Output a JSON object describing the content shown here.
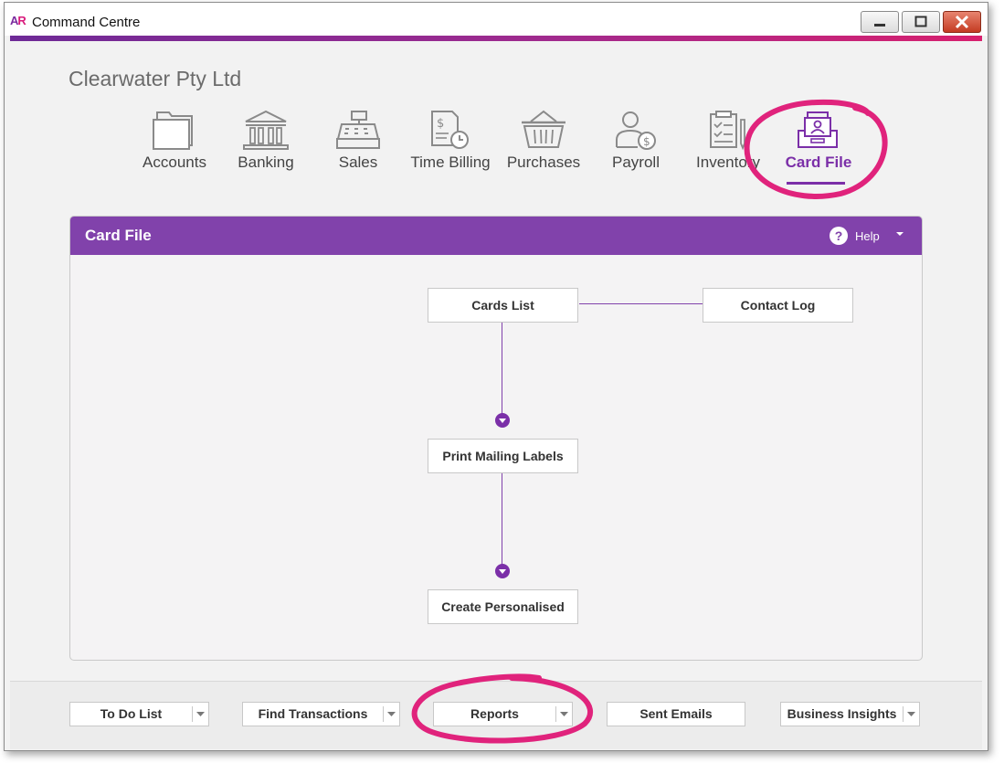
{
  "window": {
    "title": "Command Centre",
    "logo_a": "A",
    "logo_r": "R"
  },
  "company_name": "Clearwater Pty Ltd",
  "nav": {
    "tabs": [
      {
        "label": "Accounts",
        "icon": "folder-icon"
      },
      {
        "label": "Banking",
        "icon": "bank-icon"
      },
      {
        "label": "Sales",
        "icon": "cash-register-icon"
      },
      {
        "label": "Time Billing",
        "icon": "invoice-clock-icon"
      },
      {
        "label": "Purchases",
        "icon": "basket-icon"
      },
      {
        "label": "Payroll",
        "icon": "person-dollar-icon"
      },
      {
        "label": "Inventory",
        "icon": "clipboard-icon"
      },
      {
        "label": "Card File",
        "icon": "card-tray-icon",
        "active": true
      }
    ]
  },
  "panel": {
    "title": "Card File",
    "help_label": "Help",
    "flow": {
      "cards_list": "Cards List",
      "contact_log": "Contact Log",
      "print_mailing_labels": "Print Mailing Labels",
      "create_personalised": "Create Personalised"
    }
  },
  "bottom_bar": {
    "buttons": [
      {
        "label": "To Do List",
        "has_dropdown": true
      },
      {
        "label": "Find Transactions",
        "has_dropdown": true
      },
      {
        "label": "Reports",
        "has_dropdown": true
      },
      {
        "label": "Sent Emails",
        "has_dropdown": false
      },
      {
        "label": "Business Insights",
        "has_dropdown": true
      }
    ]
  },
  "colors": {
    "accent_purple": "#8142ab",
    "highlight_pink": "#e0237c",
    "active_tab": "#7b2fa8"
  }
}
